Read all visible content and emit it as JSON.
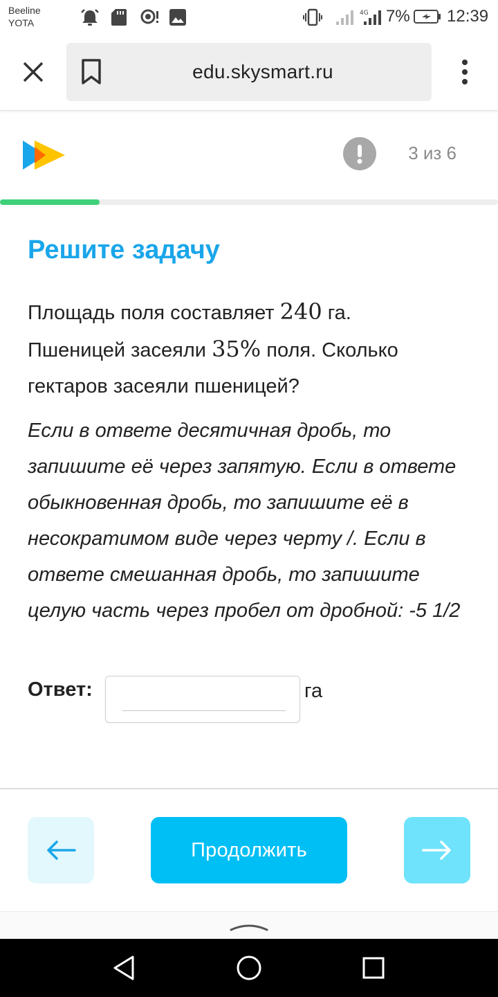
{
  "status_bar": {
    "carrier_line1": "Beeline",
    "carrier_line2": "YOTA",
    "battery": "7%",
    "time": "12:39",
    "network": "4G",
    "icons": [
      "alarm-icon",
      "sd-card-icon",
      "hotspot-icon",
      "image-icon",
      "vibrate-icon",
      "signal-icon",
      "battery-icon"
    ]
  },
  "browser": {
    "url": "edu.skysmart.ru",
    "icons": [
      "close-icon",
      "bookmark-icon",
      "more-vert-icon"
    ]
  },
  "header": {
    "counter": "3 из 6",
    "progress": 0.2,
    "logo_colors": [
      "#1aa6ea",
      "#ffc400",
      "#ff6a00"
    ],
    "icons": [
      "logo-icon",
      "exclamation-icon"
    ]
  },
  "task": {
    "title": "Решите задачу",
    "problem_part1": "Площадь поля составляет ",
    "area_value": "240",
    "problem_part2": " га.",
    "problem_part3": "Пшеницей засеяли ",
    "percent_value": "35%",
    "problem_part4": " поля. Сколько",
    "problem_part5": "гектаров засеяли пшеницей?",
    "hint": "Если в ответе десятичная дробь, то запишите её через запятую. Если в ответе обыкновенная дробь, то запишите её в несократимом виде через черту /. Если в ответе смешанная дробь, то запишите целую часть через пробел от дробной: -5 1/2",
    "answer_label": "Ответ:",
    "answer_value": "",
    "unit": "га"
  },
  "footer": {
    "continue_label": "Продолжить",
    "icons": [
      "arrow-left-icon",
      "arrow-right-icon",
      "chevron-up-icon"
    ]
  },
  "nav": {
    "icons": [
      "back-triangle-icon",
      "home-circle-icon",
      "recents-square-icon"
    ]
  },
  "colors": {
    "accent": "#1aa6ea",
    "button": "#00bff5",
    "progress": "#3fd17a"
  }
}
